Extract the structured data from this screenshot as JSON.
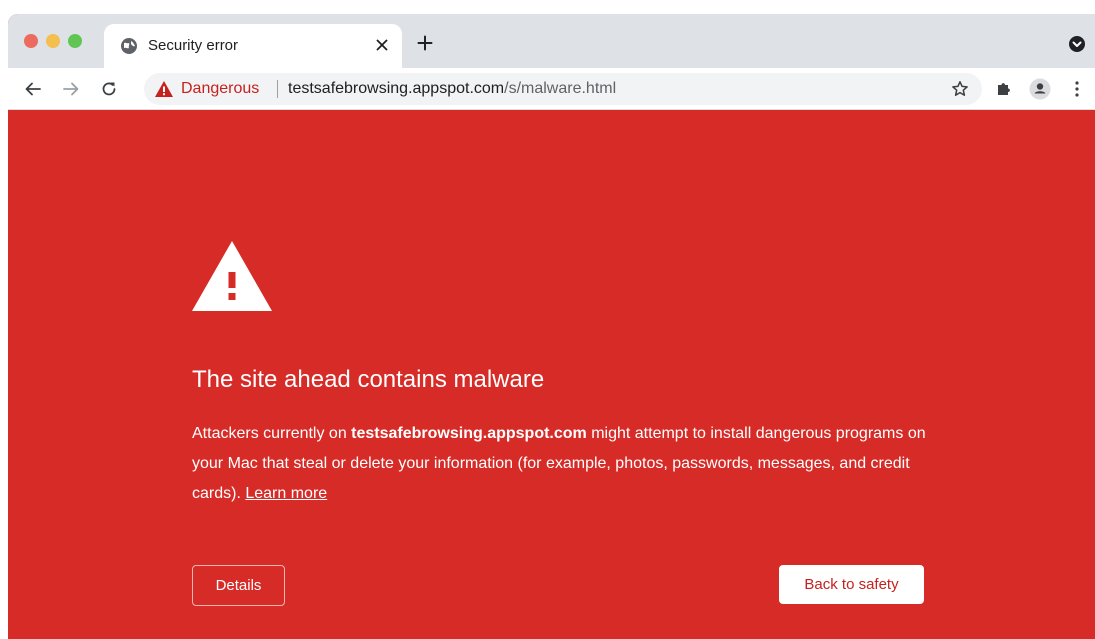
{
  "tab": {
    "title": "Security error",
    "favicon": "globe-icon",
    "close_icon": "close-icon",
    "new_tab_icon": "plus-icon"
  },
  "toolbar": {
    "back_icon": "back-arrow-icon",
    "forward_icon": "forward-arrow-icon",
    "reload_icon": "reload-icon",
    "security_label": "Dangerous",
    "url_host": "testsafebrowsing.appspot.com",
    "url_path": "/s/malware.html",
    "bookmark_icon": "star-icon",
    "extensions_icon": "puzzle-icon",
    "profile_icon": "profile-icon",
    "menu_icon": "kebab-menu-icon"
  },
  "interstitial": {
    "headline": "The site ahead contains malware",
    "explanation_prefix": "Attackers currently on ",
    "explanation_site": "testsafebrowsing.appspot.com",
    "explanation_suffix": " might attempt to install dangerous programs on your Mac that steal or delete your information (for example, photos, passwords, messages, and credit cards). ",
    "learn_more": "Learn more",
    "details_button": "Details",
    "back_to_safety_button": "Back to safety"
  },
  "colors": {
    "interstitial_background": "#d62b27",
    "danger_text": "#c5221f",
    "tabstrip": "#dee1e6",
    "omnibox": "#f1f3f4"
  }
}
